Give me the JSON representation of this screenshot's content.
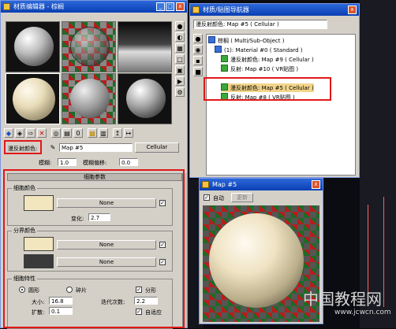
{
  "material_editor": {
    "title": "材质编辑器 - 棕榈",
    "map_label": "漫反射颜色:",
    "map_value": "Map #5",
    "map_type": "Cellular",
    "blur_label": "模糊:",
    "blur_value": "1.0",
    "blur_offset_label": "模糊偏移:",
    "blur_offset_value": "0.0"
  },
  "cellular_params": {
    "rollout_title": "细胞参数",
    "cell_color_label": "细胞颜色",
    "none_label": "None",
    "variation_label": "变化:",
    "variation_value": "2.7",
    "division_colors_label": "分界颜色",
    "cell_char_label": "细胞特性",
    "round_label": "圆形",
    "chips_label": "碎片",
    "fractal_label": "分形",
    "size_label": "大小:",
    "size_value": "16.8",
    "iterations_label": "迭代次数:",
    "iterations_value": "2.2",
    "spread_label": "扩散:",
    "spread_value": "0.1",
    "adaptive_label": "自适应",
    "colors": {
      "cell_color": "#f2e6bf",
      "division_color_1": "#f2e6bf",
      "division_color_2": "#3a3a3a",
      "highlight_red": "#e01818"
    }
  },
  "navigator": {
    "title": "材质/贴图导航器",
    "header_map": "漫反射颜色: Map #5 ( Cellular )",
    "tree": [
      "棕榈 ( Multi/Sub-Object )",
      "(1): Material #0 ( Standard )",
      "漫反射颜色: Map #9 ( Cellular )",
      "反射: Map #10 ( VR贴图 )",
      "漫反射颜色: Map #5 ( Cellular )",
      "反射: Map #8 ( VR贴图 )"
    ]
  },
  "map_preview": {
    "title": "Map #5",
    "auto_label": "自动",
    "update_label": "更新"
  },
  "watermark": {
    "text": "中国教程网",
    "url": "www.jcwcn.com"
  }
}
